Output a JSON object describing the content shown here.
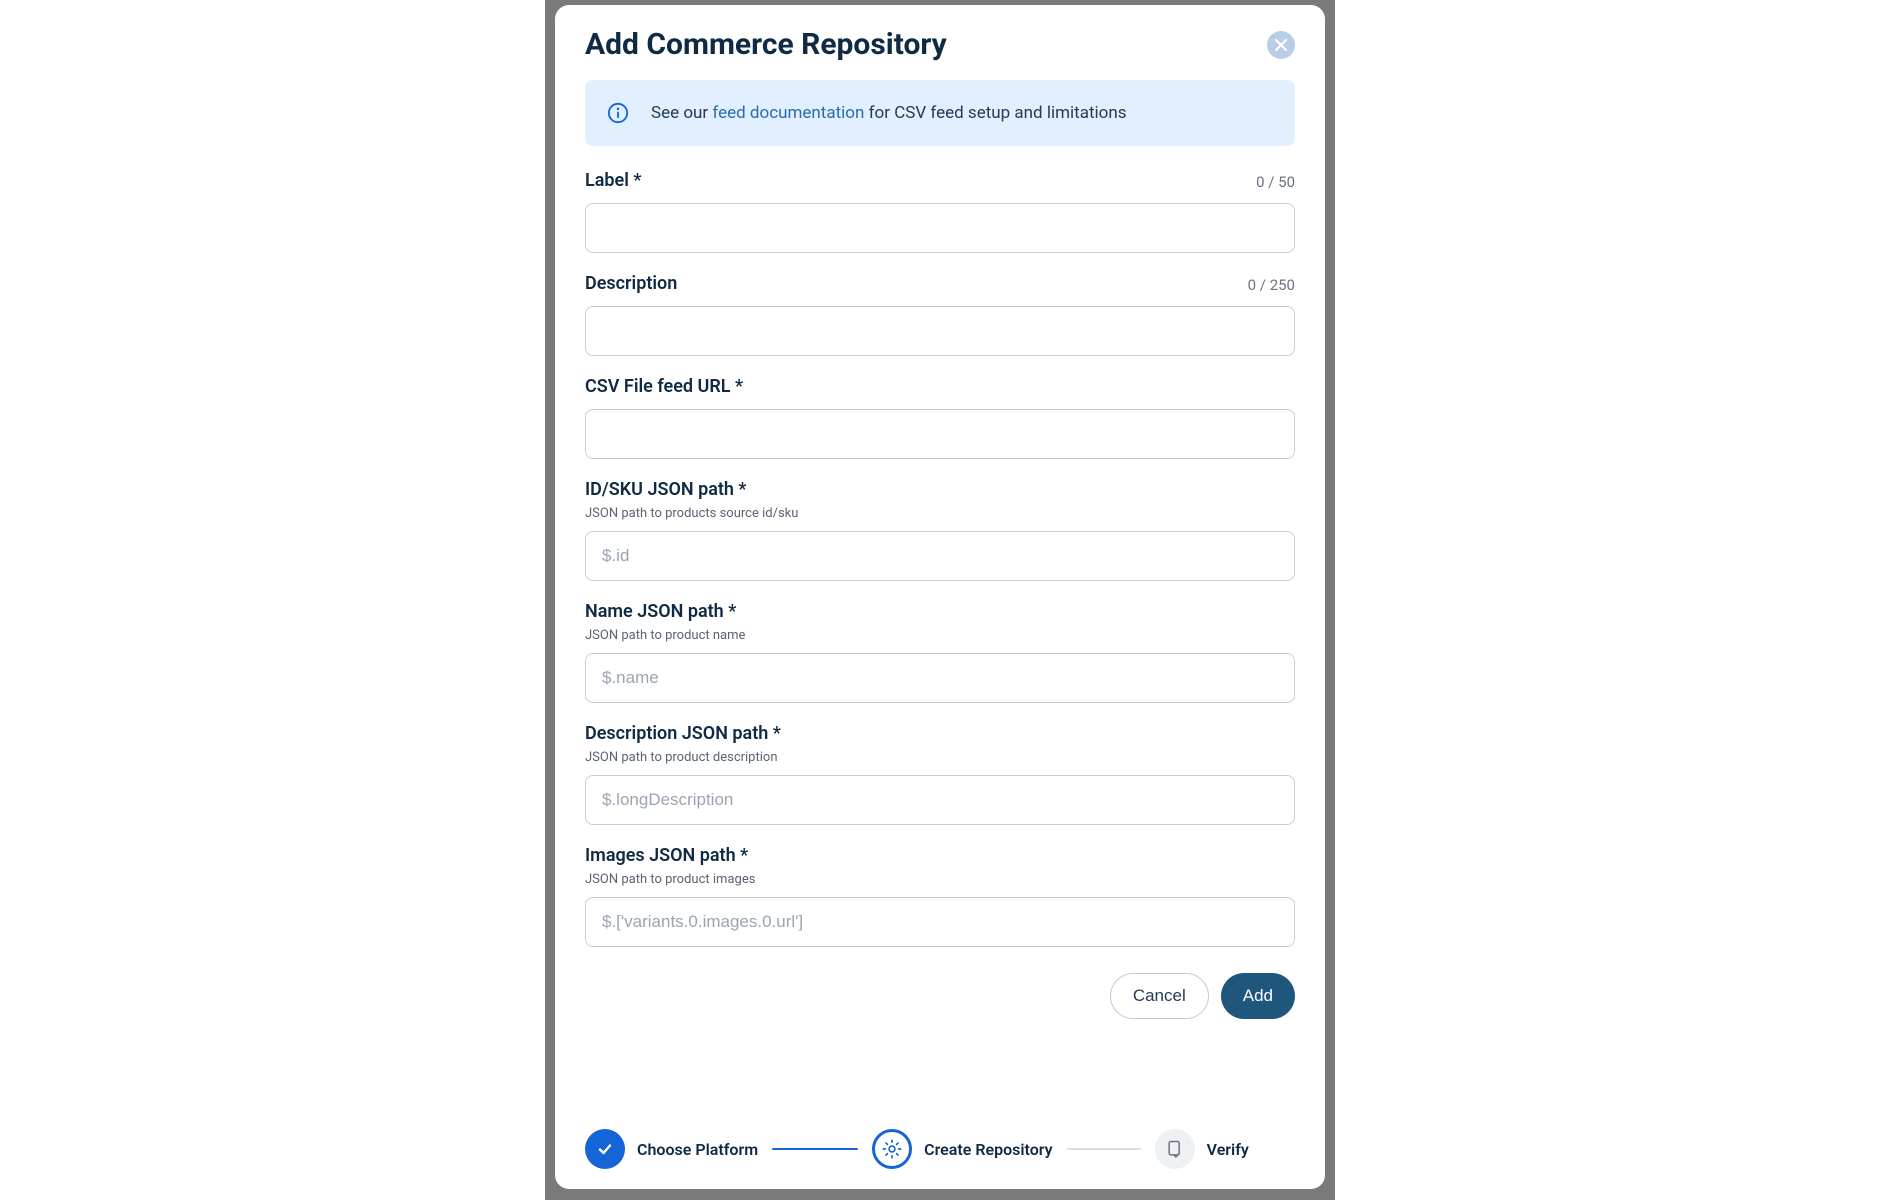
{
  "modal": {
    "title": "Add Commerce Repository",
    "info_prefix": "See our ",
    "info_link": "feed documentation",
    "info_suffix": " for CSV feed setup and limitations"
  },
  "fields": {
    "label": {
      "label": "Label *",
      "counter": "0 / 50",
      "value": "",
      "placeholder": ""
    },
    "description": {
      "label": "Description",
      "counter": "0 / 250",
      "value": "",
      "placeholder": ""
    },
    "csv_url": {
      "label": "CSV File feed URL *",
      "value": "",
      "placeholder": ""
    },
    "id_sku_path": {
      "label": "ID/SKU JSON path *",
      "help": "JSON path to products source id/sku",
      "value": "",
      "placeholder": "$.id"
    },
    "name_path": {
      "label": "Name JSON path *",
      "help": "JSON path to product name",
      "value": "",
      "placeholder": "$.name"
    },
    "desc_path": {
      "label": "Description JSON path *",
      "help": "JSON path to product description",
      "value": "",
      "placeholder": "$.longDescription"
    },
    "images_path": {
      "label": "Images JSON path *",
      "help": "JSON path to product images",
      "value": "",
      "placeholder": "$.['variants.0.images.0.url']"
    }
  },
  "actions": {
    "cancel": "Cancel",
    "add": "Add"
  },
  "steps": {
    "choose": "Choose Platform",
    "create": "Create Repository",
    "verify": "Verify"
  }
}
